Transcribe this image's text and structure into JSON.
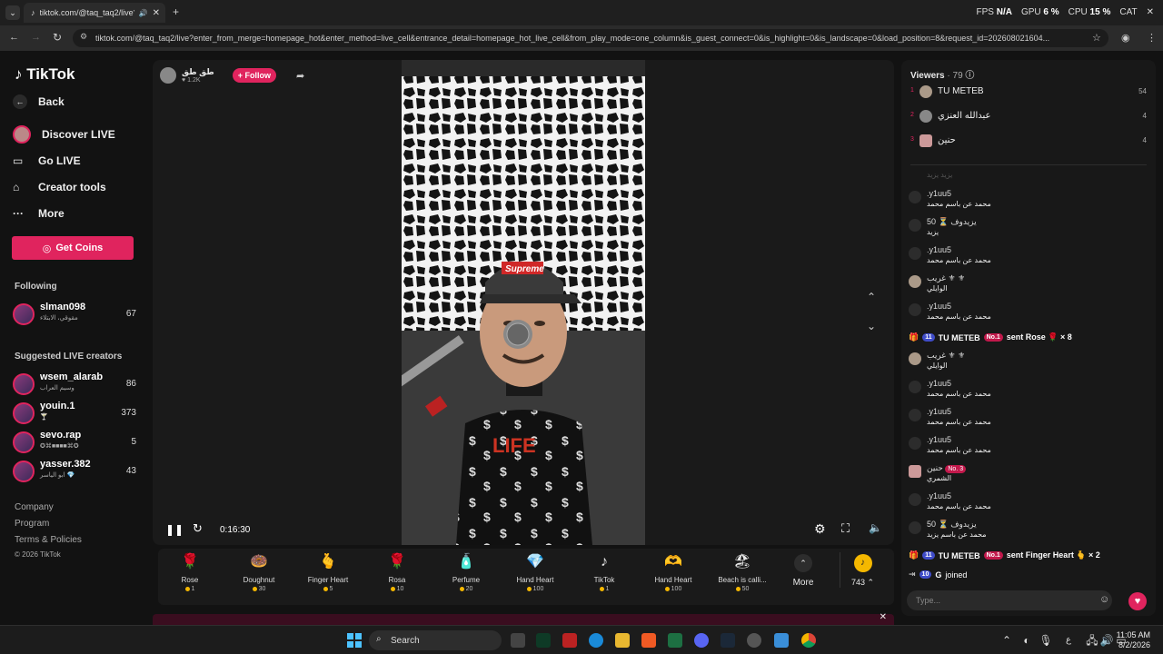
{
  "browser": {
    "tab_title": "tiktok.com/@taq_taq2/live?",
    "url": "tiktok.com/@taq_taq2/live?enter_from_merge=homepage_hot&enter_method=live_cell&entrance_detail=homepage_hot_live_cell&from_play_mode=one_column&is_guest_connect=0&is_highlight=0&is_landscape=0&load_position=8&request_id=202608021604...",
    "stats": {
      "fps_label": "FPS",
      "fps": "N/A",
      "gpu_label": "GPU",
      "gpu": "6 %",
      "cpu_label": "CPU",
      "cpu": "15 %",
      "cat_label": "CAT"
    }
  },
  "sidebar": {
    "logo": "TikTok",
    "back": "Back",
    "nav": [
      "Discover LIVE",
      "Go LIVE",
      "Creator tools",
      "More"
    ],
    "get_coins": "Get Coins",
    "following_title": "Following",
    "following": [
      {
        "name": "slman098",
        "sub": "مقوقي، الابتلاء",
        "count": "67"
      }
    ],
    "suggested_title": "Suggested LIVE creators",
    "suggested": [
      {
        "name": "wsem_alarab",
        "sub": "وسيم العراب",
        "count": "86"
      },
      {
        "name": "youin.1",
        "sub": "🍸",
        "count": "373"
      },
      {
        "name": "sevo.rap",
        "sub": "✪⌘■■■■⌘✪",
        "count": "5"
      },
      {
        "name": "yasser.382",
        "sub": "ابو الياسر 💎",
        "count": "43"
      }
    ],
    "footer": [
      "Company",
      "Program",
      "Terms & Policies",
      "© 2026 TikTok"
    ]
  },
  "stream": {
    "host_name": "طق طق",
    "host_likes": "1.2K",
    "follow": "+ Follow",
    "time": "0:16:30"
  },
  "gifts": [
    {
      "name": "Rose",
      "price": "1",
      "icon": "🌹"
    },
    {
      "name": "Doughnut",
      "price": "30",
      "icon": "🍩"
    },
    {
      "name": "Finger Heart",
      "price": "5",
      "icon": "🫰"
    },
    {
      "name": "Rosa",
      "price": "10",
      "icon": "🌹"
    },
    {
      "name": "Perfume",
      "price": "20",
      "icon": "🧴"
    },
    {
      "name": "Hand Heart",
      "price": "100",
      "icon": "💎"
    },
    {
      "name": "TikTok",
      "price": "1",
      "icon": "♪"
    },
    {
      "name": "Hand Heart",
      "price": "100",
      "icon": "🫶"
    },
    {
      "name": "Beach is calli...",
      "price": "50",
      "icon": "🏖"
    }
  ],
  "gift_more": "More",
  "coins_balance": "743",
  "chat": {
    "viewers_title": "Viewers",
    "viewers_count": "· 79",
    "top_viewers": [
      {
        "rank": "1",
        "name": "TU METEB",
        "score": "54"
      },
      {
        "rank": "2",
        "name": "عبدالله العنزي",
        "score": "4"
      },
      {
        "rank": "3",
        "name": "حنين",
        "score": "4"
      }
    ],
    "faded_msg": "يزيد يزيد",
    "messages": [
      {
        "user": ".y1uu5",
        "text": "محمد عن باسم محمد"
      },
      {
        "user": "50 ⏳ يزيدوف",
        "text": "يزيد"
      },
      {
        "user": ".y1uu5",
        "text": "محمد عن باسم محمد"
      },
      {
        "user": "غريب ⚜ ⚜",
        "text": "الوايلي"
      },
      {
        "user": ".y1uu5",
        "text": "محمد عن باسم محمد"
      },
      {
        "system": true,
        "badge": "11",
        "user": "TU METEB",
        "no": "No.1",
        "text": "sent Rose 🌹 × 8"
      },
      {
        "user": "غريب ⚜ ⚜",
        "text": "الوايلي"
      },
      {
        "user": ".y1uu5",
        "text": "محمد عن باسم محمد"
      },
      {
        "user": ".y1uu5",
        "text": "محمد عن باسم محمد"
      },
      {
        "user": ".y1uu5",
        "text": "محمد عن باسم محمد"
      },
      {
        "user": "حنين",
        "no": "No. 3",
        "text": "الشمري"
      },
      {
        "user": ".y1uu5",
        "text": "محمد عن باسم محمد"
      },
      {
        "user": "50 ⏳ يزيدوف",
        "text": "محمد عن باسم يزيد"
      },
      {
        "system": true,
        "badge": "11",
        "user": "TU METEB",
        "no": "No.1",
        "text": "sent Finger Heart 🫰 × 2"
      },
      {
        "system": true,
        "badge": "10",
        "user": "G",
        "text": "joined"
      }
    ],
    "input_placeholder": "Type..."
  },
  "taskbar": {
    "search": "Search",
    "time": "11:05 AM",
    "date": "8/2/2026",
    "lang": "ع"
  }
}
